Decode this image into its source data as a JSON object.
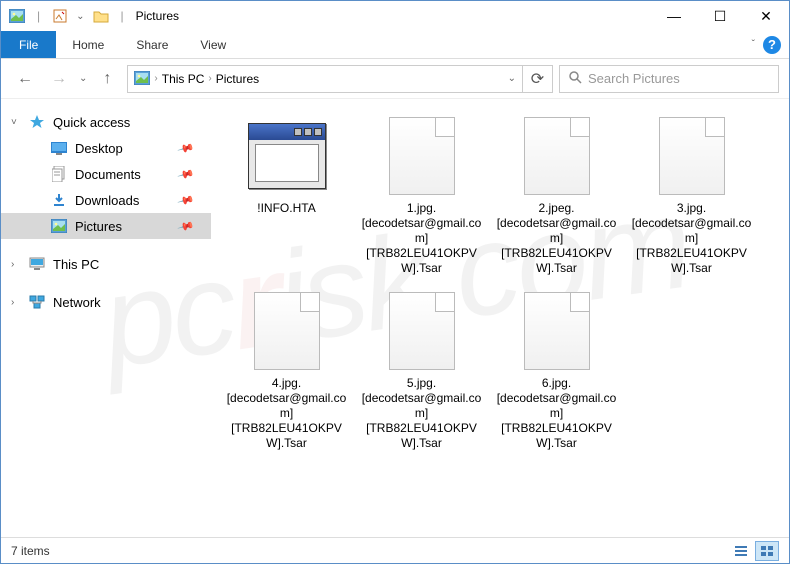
{
  "titlebar": {
    "title": "Pictures",
    "sep": "|"
  },
  "ribbon": {
    "file": "File",
    "tabs": [
      "Home",
      "Share",
      "View"
    ],
    "expand": "ˇ",
    "help": "?"
  },
  "nav": {
    "back": "←",
    "forward": "→",
    "history": "⌄",
    "up": "↑",
    "breadcrumb": [
      "This PC",
      "Pictures"
    ],
    "sep": "›",
    "dropdown": "⌄",
    "refresh": "⟳",
    "search_placeholder": "Search Pictures"
  },
  "sidebar": {
    "quick_access": {
      "label": "Quick access",
      "expander": "˅"
    },
    "items": [
      {
        "label": "Desktop",
        "pinned": true
      },
      {
        "label": "Documents",
        "pinned": true
      },
      {
        "label": "Downloads",
        "pinned": true
      },
      {
        "label": "Pictures",
        "pinned": true,
        "selected": true
      }
    ],
    "this_pc": {
      "label": "This PC",
      "expander": "›"
    },
    "network": {
      "label": "Network",
      "expander": "›"
    }
  },
  "files": [
    {
      "name": "!INFO.HTA",
      "type": "hta"
    },
    {
      "name": "1.jpg.[decodetsar@gmail.com][TRB82LEU41OKPVW].Tsar",
      "type": "unknown"
    },
    {
      "name": "2.jpeg.[decodetsar@gmail.com][TRB82LEU41OKPVW].Tsar",
      "type": "unknown"
    },
    {
      "name": "3.jpg.[decodetsar@gmail.com][TRB82LEU41OKPVW].Tsar",
      "type": "unknown"
    },
    {
      "name": "4.jpg.[decodetsar@gmail.com][TRB82LEU41OKPVW].Tsar",
      "type": "unknown"
    },
    {
      "name": "5.jpg.[decodetsar@gmail.com][TRB82LEU41OKPVW].Tsar",
      "type": "unknown"
    },
    {
      "name": "6.jpg.[decodetsar@gmail.com][TRB82LEU41OKPVW].Tsar",
      "type": "unknown"
    }
  ],
  "statusbar": {
    "count_label": "7 items"
  },
  "watermark": {
    "pc": "pc",
    "r": "r",
    "isk": "isk",
    "com": ".com"
  }
}
